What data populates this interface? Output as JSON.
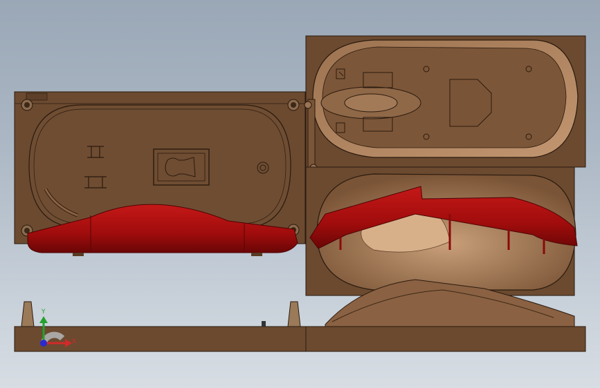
{
  "viewport": {
    "background_top": "#9aa7b6",
    "background_bottom": "#d7dde3"
  },
  "colors": {
    "mold_body": "#6b4a30",
    "mold_edge": "#2a1a0e",
    "mold_cavity": "#8a6142",
    "mold_highlight": "#b68a62",
    "part_red": "#a80f0f",
    "part_red_dark": "#6a0606",
    "axis_x": "#d22a2a",
    "axis_y": "#23a12c",
    "axis_z": "#2a2ad2"
  },
  "triad": {
    "x_label": "X",
    "y_label": "Y"
  },
  "icons": [
    "coordinate-triad-icon"
  ]
}
